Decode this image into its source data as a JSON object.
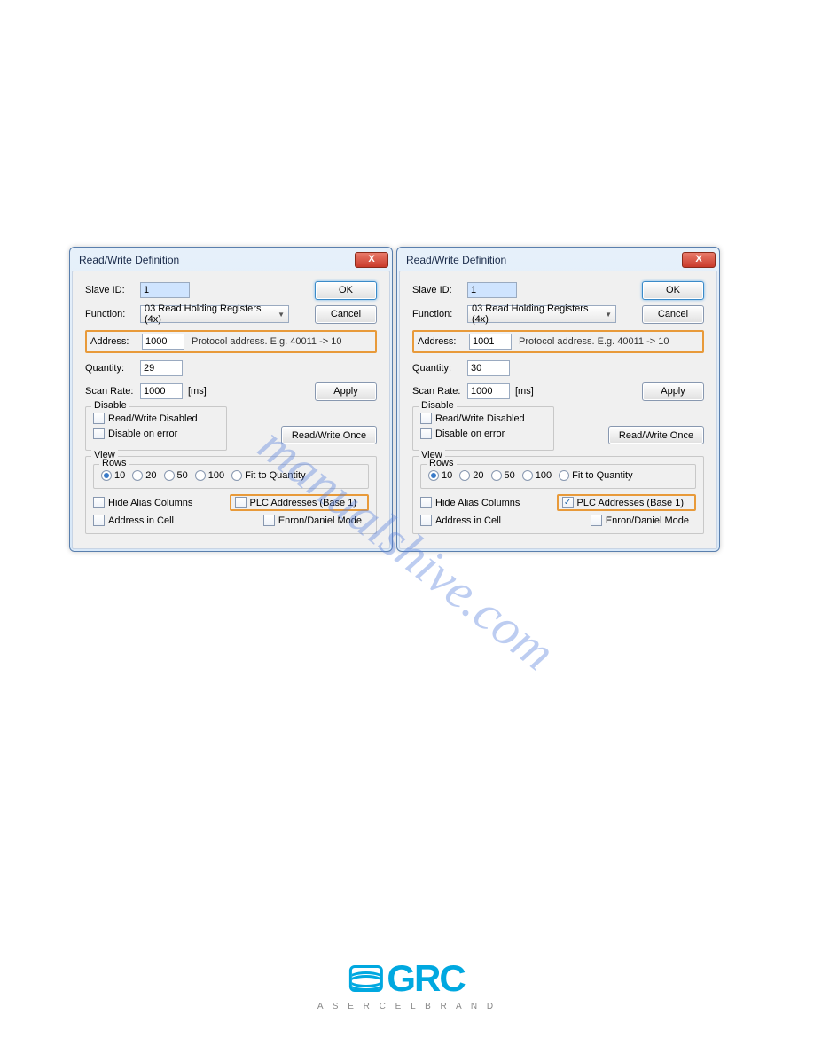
{
  "watermark": "manualshive.com",
  "logo": {
    "brand": "GRC",
    "tagline": "A   S E R C E L   B R A N D"
  },
  "dialogs": [
    {
      "title": "Read/Write Definition",
      "slaveId_label": "Slave ID:",
      "slaveId_value": "1",
      "function_label": "Function:",
      "function_value": "03 Read Holding Registers (4x)",
      "address_label": "Address:",
      "address_value": "1000",
      "address_hint": "Protocol address. E.g. 40011 -> 10",
      "quantity_label": "Quantity:",
      "quantity_value": "29",
      "scanrate_label": "Scan Rate:",
      "scanrate_value": "1000",
      "scanrate_unit": "[ms]",
      "disable_legend": "Disable",
      "disable_rw": "Read/Write Disabled",
      "disable_err": "Disable on error",
      "view_legend": "View",
      "rows_legend": "Rows",
      "rows": [
        "10",
        "20",
        "50",
        "100",
        "Fit to Quantity"
      ],
      "rows_selected": 0,
      "hide_alias": "Hide Alias Columns",
      "plc_addr": "PLC Addresses (Base 1)",
      "plc_checked": false,
      "addr_cell": "Address in Cell",
      "enron": "Enron/Daniel Mode",
      "ok": "OK",
      "cancel": "Cancel",
      "apply": "Apply",
      "rwonce": "Read/Write Once"
    },
    {
      "title": "Read/Write Definition",
      "slaveId_label": "Slave ID:",
      "slaveId_value": "1",
      "function_label": "Function:",
      "function_value": "03 Read Holding Registers (4x)",
      "address_label": "Address:",
      "address_value": "1001",
      "address_hint": "Protocol address. E.g. 40011 -> 10",
      "quantity_label": "Quantity:",
      "quantity_value": "30",
      "scanrate_label": "Scan Rate:",
      "scanrate_value": "1000",
      "scanrate_unit": "[ms]",
      "disable_legend": "Disable",
      "disable_rw": "Read/Write Disabled",
      "disable_err": "Disable on error",
      "view_legend": "View",
      "rows_legend": "Rows",
      "rows": [
        "10",
        "20",
        "50",
        "100",
        "Fit to Quantity"
      ],
      "rows_selected": 0,
      "hide_alias": "Hide Alias Columns",
      "plc_addr": "PLC Addresses (Base 1)",
      "plc_checked": true,
      "addr_cell": "Address in Cell",
      "enron": "Enron/Daniel Mode",
      "ok": "OK",
      "cancel": "Cancel",
      "apply": "Apply",
      "rwonce": "Read/Write Once"
    }
  ]
}
